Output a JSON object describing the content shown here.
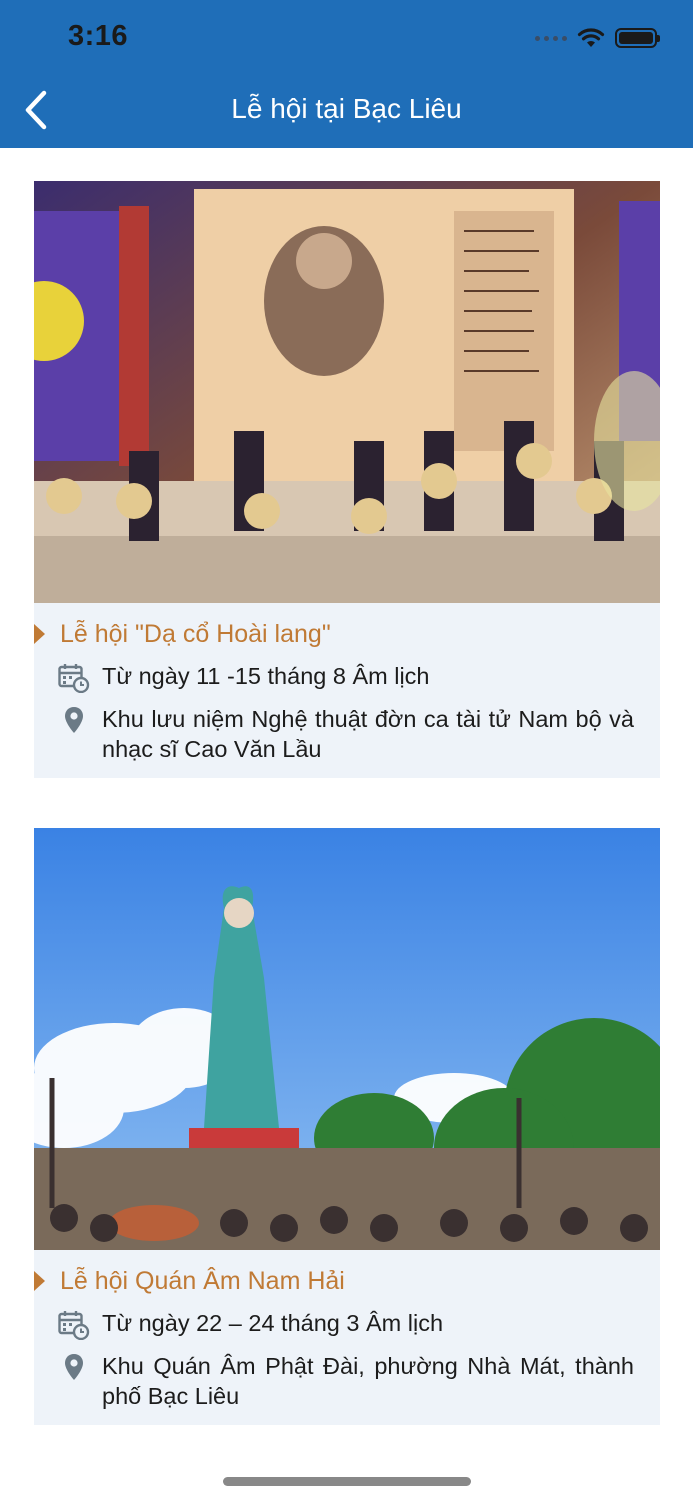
{
  "status_bar": {
    "time": "3:16"
  },
  "nav": {
    "title": "Lễ hội tại Bạc Liêu"
  },
  "colors": {
    "header": "#1f6eb8",
    "title_accent": "#c07a35",
    "card_bg": "#eef3f9"
  },
  "festivals": [
    {
      "image": "music-stage-performance-photo",
      "title": "Lễ hội \"Dạ cổ Hoài lang\"",
      "date": "Từ ngày 11 -15 tháng 8 Âm lịch",
      "location": " Khu lưu niệm Nghệ thuật đờn ca tài tử Nam bộ và nhạc sĩ Cao Văn Lầu"
    },
    {
      "image": "guanyin-statue-photo",
      "title": "Lễ hội Quán Âm Nam Hải",
      "date": "Từ ngày 22 – 24 tháng 3 Âm lịch",
      "location": "Khu Quán Âm Phật Đài, phường Nhà Mát, thành phố Bạc Liêu"
    }
  ]
}
